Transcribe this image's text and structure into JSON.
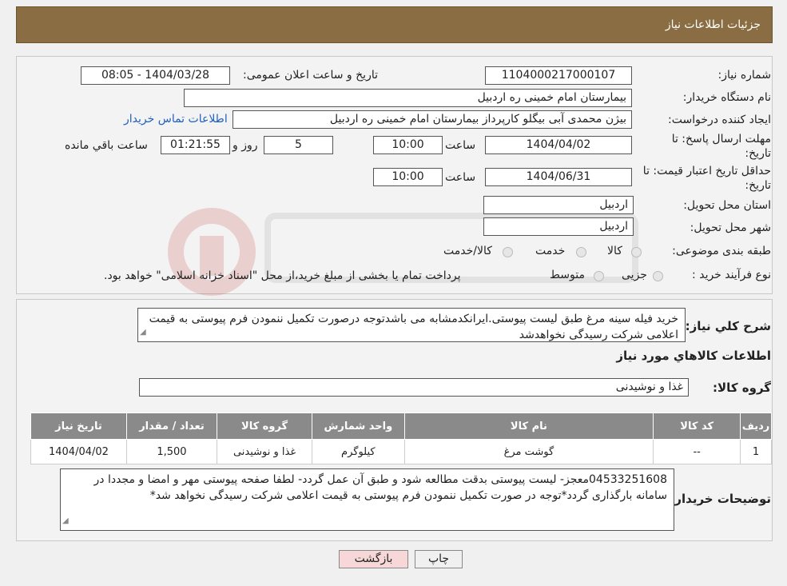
{
  "header": {
    "title": "جزئیات اطلاعات نیاز"
  },
  "need": {
    "number_label": "شماره نیاز:",
    "number_value": "1104000217000107",
    "announce_label": "تاریخ و ساعت اعلان عمومی:",
    "announce_value": "1404/03/28 - 08:05",
    "buyer_label": "نام دستگاه خریدار:",
    "buyer_value": "بیمارستان امام خمینی  ره  اردبیل",
    "creator_label": "ایجاد کننده درخواست:",
    "creator_value": "بیژن محمدی آبی بیگلو کارپرداز بیمارستان امام خمینی  ره  اردبیل",
    "contact_link": "اطلاعات تماس خریدار",
    "deadline_label_1": "مهلت ارسال پاسخ: تا",
    "deadline_label_2": "تاریخ:",
    "deadline_date": "1404/04/02",
    "time_label": "ساعت",
    "deadline_time": "10:00",
    "days_value": "5",
    "days_label": "روز و",
    "remaining_value": "01:21:55",
    "remaining_label": "ساعت باقي مانده",
    "validity_label_1": "حداقل تاریخ اعتبار قیمت: تا",
    "validity_label_2": "تاریخ:",
    "validity_date": "1404/06/31",
    "validity_time": "10:00",
    "province_label": "استان محل تحویل:",
    "province_value": "اردبیل",
    "city_label": "شهر محل تحویل:",
    "city_value": "اردبیل",
    "category_label": "طبقه بندی موضوعی:",
    "category_options": [
      "کالا",
      "خدمت",
      "کالا/خدمت"
    ],
    "process_label": "نوع فرآیند خرید :",
    "process_options": [
      "جزیی",
      "متوسط"
    ],
    "process_note": "پرداخت تمام یا بخشی از مبلغ خرید،از محل \"اسناد خزانه اسلامی\" خواهد بود."
  },
  "description": {
    "label": "شرح کلي نياز:",
    "text": "خرید فیله سینه مرغ طبق لیست پیوستی.ایرانکدمشابه می باشدتوجه درصورت تکمیل ننمودن فرم پیوستی به قیمت اعلامی شرکت رسیدگی نخواهدشد"
  },
  "goods": {
    "section_title": "اطلاعات کالاهاي مورد نياز",
    "group_label": "گروه کالا:",
    "group_value": "غذا و نوشیدنی",
    "columns": [
      "رديف",
      "کد کالا",
      "نام کالا",
      "واحد شمارش",
      "گروه کالا",
      "تعداد / مقدار",
      "تاریخ نیاز"
    ],
    "rows": [
      [
        "1",
        "--",
        "گوشت مرغ",
        "کیلوگرم",
        "غذا و نوشیدنی",
        "1,500",
        "1404/04/02"
      ]
    ]
  },
  "buyer_notes": {
    "label": "توضیحات خریدار:",
    "text": "04533251608معجز- لیست پیوستی بدقت مطالعه شود و طبق آن عمل گردد- لطفا صفحه پیوستی مهر و امضا و مجددا در سامانه بارگذاری گردد*توجه در صورت تکمیل ننمودن فرم پیوستی به قیمت اعلامی شرکت رسیدگی نخواهد شد*"
  },
  "buttons": {
    "print": "چاپ",
    "back": "بازگشت"
  },
  "colors": {
    "header": "#8a6d42",
    "table_header": "#8a8a8a",
    "link": "#2060c0",
    "back_button": "#f7d7d7"
  }
}
